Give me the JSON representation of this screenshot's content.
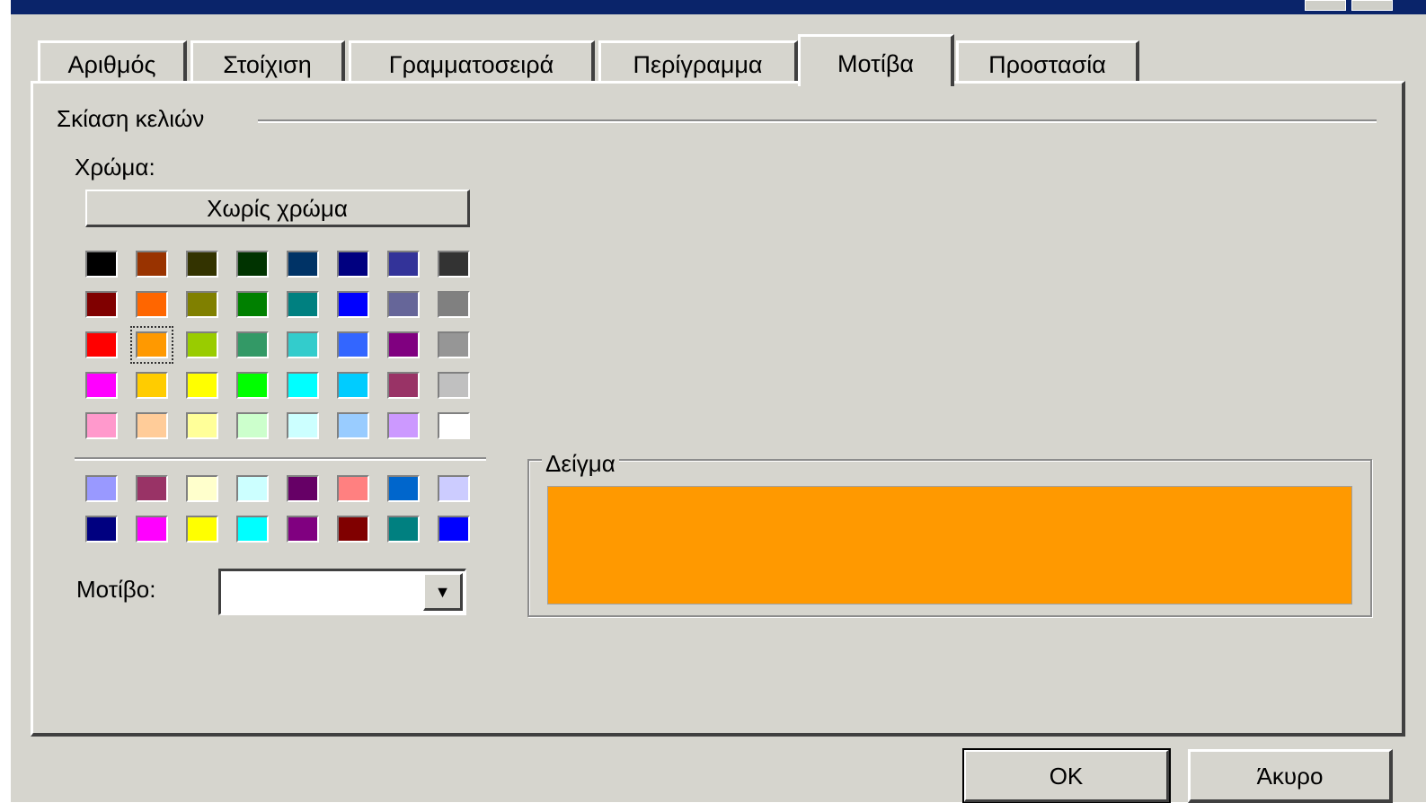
{
  "tabs": [
    {
      "label": "Αριθμός"
    },
    {
      "label": "Στοίχιση"
    },
    {
      "label": "Γραμματοσειρά"
    },
    {
      "label": "Περίγραμμα"
    },
    {
      "label": "Μοτίβα"
    },
    {
      "label": "Προστασία"
    }
  ],
  "active_tab": "Μοτίβα",
  "group": {
    "label": "Σκίαση κελιών"
  },
  "color": {
    "label": "Χρώμα:",
    "no_color_label": "Χωρίς χρώμα",
    "selected": "#ff9900",
    "palette": [
      [
        "#000000",
        "#993300",
        "#333300",
        "#003300",
        "#003366",
        "#000080",
        "#333399",
        "#333333"
      ],
      [
        "#800000",
        "#ff6600",
        "#808000",
        "#008000",
        "#008080",
        "#0000ff",
        "#666699",
        "#808080"
      ],
      [
        "#ff0000",
        "#ff9900",
        "#99cc00",
        "#339966",
        "#33cccc",
        "#3366ff",
        "#800080",
        "#969696"
      ],
      [
        "#ff00ff",
        "#ffcc00",
        "#ffff00",
        "#00ff00",
        "#00ffff",
        "#00ccff",
        "#993366",
        "#c0c0c0"
      ],
      [
        "#ff99cc",
        "#ffcc99",
        "#ffff99",
        "#ccffcc",
        "#ccffff",
        "#99ccff",
        "#cc99ff",
        "#ffffff"
      ]
    ],
    "chart_palette": [
      [
        "#9999ff",
        "#993366",
        "#ffffcc",
        "#ccffff",
        "#660066",
        "#ff8080",
        "#0066cc",
        "#ccccff"
      ],
      [
        "#000080",
        "#ff00ff",
        "#ffff00",
        "#00ffff",
        "#800080",
        "#800000",
        "#008080",
        "#0000ff"
      ]
    ]
  },
  "pattern": {
    "label": "Μοτίβο:",
    "value": ""
  },
  "sample": {
    "label": "Δείγμα",
    "color": "#ff9900"
  },
  "buttons": {
    "ok": "OK",
    "cancel": "Άκυρο"
  }
}
